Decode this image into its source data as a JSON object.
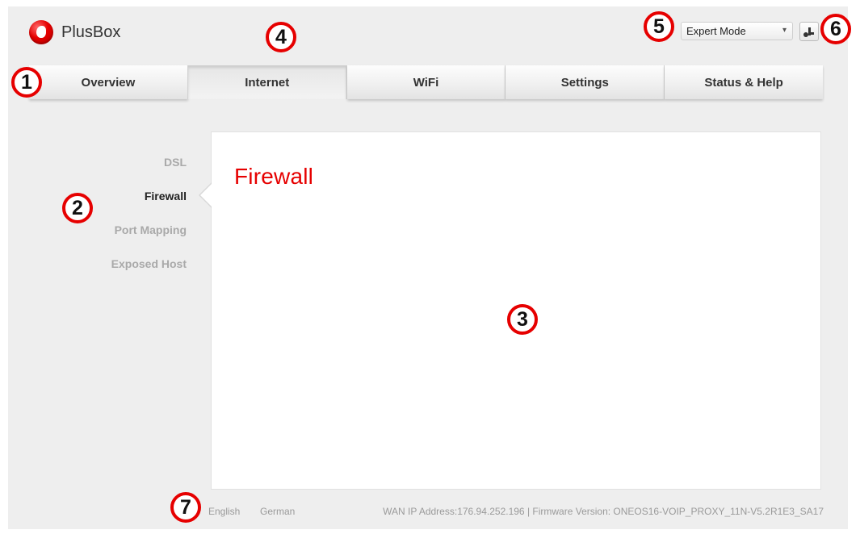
{
  "app": {
    "name": "PlusBox"
  },
  "header": {
    "mode_select": {
      "value": "Expert Mode"
    }
  },
  "tabs": [
    {
      "label": "Overview"
    },
    {
      "label": "Internet"
    },
    {
      "label": "WiFi"
    },
    {
      "label": "Settings"
    },
    {
      "label": "Status & Help"
    }
  ],
  "active_tab": "Internet",
  "sidebar": {
    "items": [
      {
        "label": "DSL"
      },
      {
        "label": "Firewall"
      },
      {
        "label": "Port Mapping"
      },
      {
        "label": "Exposed Host"
      }
    ],
    "active": "Firewall"
  },
  "main": {
    "title": "Firewall"
  },
  "footer": {
    "languages": [
      "English",
      "German"
    ],
    "info": "WAN IP Address:176.94.252.196 | Firmware Version: ONEOS16-VOIP_PROXY_11N-V5.2R1E3_SA17"
  },
  "callouts": [
    "1",
    "2",
    "3",
    "4",
    "5",
    "6",
    "7"
  ],
  "colors": {
    "accent": "#e60000",
    "background": "#eeeeee",
    "panel": "#ffffff"
  },
  "icons": {
    "logo": "vodafone-speechmark-icon",
    "logout": "logout-icon",
    "dropdown": "chevron-down-icon"
  }
}
